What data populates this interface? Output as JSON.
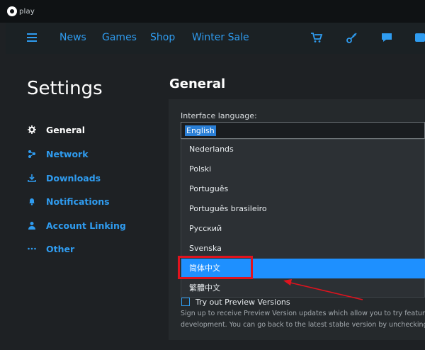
{
  "app": {
    "logo_text": "play"
  },
  "nav": {
    "items": [
      "News",
      "Games",
      "Shop",
      "Winter Sale"
    ],
    "icons": [
      "cart-icon",
      "key-icon",
      "chat-icon",
      "notification-icon"
    ]
  },
  "sidebar": {
    "title": "Settings",
    "items": [
      {
        "label": "General",
        "icon": "gear-icon",
        "active": true
      },
      {
        "label": "Network",
        "icon": "network-icon",
        "active": false
      },
      {
        "label": "Downloads",
        "icon": "download-icon",
        "active": false
      },
      {
        "label": "Notifications",
        "icon": "bell-icon",
        "active": false
      },
      {
        "label": "Account Linking",
        "icon": "user-icon",
        "active": false
      },
      {
        "label": "Other",
        "icon": "more-icon",
        "active": false
      }
    ]
  },
  "main": {
    "title": "General",
    "language": {
      "label": "Interface language:",
      "value": "English",
      "options": [
        {
          "label": "Nederlands",
          "selected": false
        },
        {
          "label": "Polski",
          "selected": false
        },
        {
          "label": "Português",
          "selected": false
        },
        {
          "label": "Português brasileiro",
          "selected": false
        },
        {
          "label": "Русский",
          "selected": false
        },
        {
          "label": "Svenska",
          "selected": false
        },
        {
          "label": "简体中文",
          "selected": true
        },
        {
          "label": "繁體中文",
          "selected": false
        }
      ]
    },
    "preview": {
      "label": "Try out Preview Versions",
      "desc_line1": "Sign up to receive Preview Version updates which allow you to try features t",
      "desc_line2": "development. You can go back to the latest stable version by unchecking this"
    }
  },
  "colors": {
    "accent": "#2f9cf0",
    "selection": "#1e90ff",
    "annotation": "#e0131e",
    "background": "#1e2124"
  }
}
